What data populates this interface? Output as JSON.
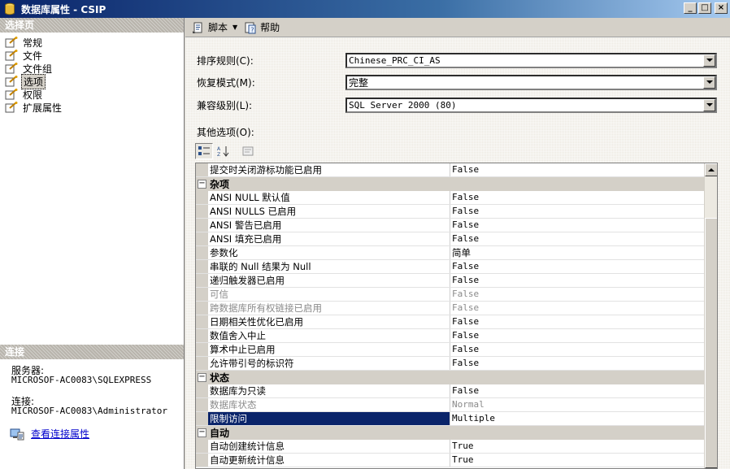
{
  "window": {
    "title": "数据库属性 - CSIP",
    "buttons": [
      "_",
      "□",
      "×"
    ]
  },
  "left_pane": {
    "header": "选择页",
    "pages": [
      {
        "label": "常规",
        "icon": "page-icon",
        "selected": false
      },
      {
        "label": "文件",
        "icon": "page-icon",
        "selected": false
      },
      {
        "label": "文件组",
        "icon": "page-icon",
        "selected": false
      },
      {
        "label": "选项",
        "icon": "page-icon",
        "selected": true
      },
      {
        "label": "权限",
        "icon": "page-icon",
        "selected": false
      },
      {
        "label": "扩展属性",
        "icon": "page-icon",
        "selected": false
      }
    ],
    "connection": {
      "header": "连接",
      "server_label": "服务器:",
      "server_value": "MICROSOF-AC0083\\SQLEXPRESS",
      "connection_label": "连接:",
      "connection_value": "MICROSOF-AC0083\\Administrator",
      "link": "查看连接属性"
    }
  },
  "toolbar": {
    "script": "脚本",
    "help": "帮助"
  },
  "fields": {
    "collation_label": "排序规则(C):",
    "collation_value": "Chinese_PRC_CI_AS",
    "recovery_label": "恢复模式(M):",
    "recovery_value": "完整",
    "compat_label": "兼容级别(L):",
    "compat_value": "SQL Server 2000 (80)",
    "other_label": "其他选项(O):"
  },
  "grid": {
    "top_row": {
      "name": "提交时关闭游标功能已启用",
      "value": "False"
    },
    "cat_misc": "杂项",
    "misc": [
      {
        "name": "ANSI NULL 默认值",
        "value": "False"
      },
      {
        "name": "ANSI NULLS 已启用",
        "value": "False"
      },
      {
        "name": "ANSI 警告已启用",
        "value": "False"
      },
      {
        "name": "ANSI 填充已启用",
        "value": "False"
      },
      {
        "name": "参数化",
        "value": "简单"
      },
      {
        "name": "串联的 Null 结果为 Null",
        "value": "False"
      },
      {
        "name": "递归触发器已启用",
        "value": "False"
      },
      {
        "name": "可信",
        "value": "False"
      },
      {
        "name": "跨数据库所有权链接已启用",
        "value": "False"
      },
      {
        "name": "日期相关性优化已启用",
        "value": "False"
      },
      {
        "name": "数值舍入中止",
        "value": "False"
      },
      {
        "name": "算术中止已启用",
        "value": "False"
      },
      {
        "name": "允许带引号的标识符",
        "value": "False"
      }
    ],
    "cat_state": "状态",
    "state": [
      {
        "name": "数据库为只读",
        "value": "False"
      },
      {
        "name": "数据库状态",
        "value": "Normal"
      },
      {
        "name": "限制访问",
        "value": "Multiple"
      }
    ],
    "cat_auto": "自动",
    "auto": [
      {
        "name": "自动创建统计信息",
        "value": "True"
      },
      {
        "name": "自动更新统计信息",
        "value": "True"
      }
    ]
  },
  "colors": {
    "title_bar": "#0a246a",
    "selection": "#0a246a",
    "link": "#0000cc",
    "disabled_text": "#8a8a8a"
  }
}
